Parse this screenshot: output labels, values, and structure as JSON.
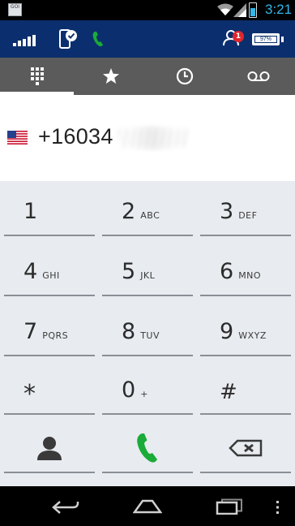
{
  "status_bar": {
    "app_icon_text": "GOI",
    "time": "3:21"
  },
  "header": {
    "contacts_badge": "1",
    "battery_percent": "97%"
  },
  "tabs": [
    {
      "name": "dialpad",
      "icon": "dialpad-icon",
      "active": true
    },
    {
      "name": "favorites",
      "icon": "star-icon",
      "active": false
    },
    {
      "name": "recents",
      "icon": "clock-icon",
      "active": false
    },
    {
      "name": "voicemail",
      "icon": "voicemail-icon",
      "active": false
    }
  ],
  "dial": {
    "country_flag": "us-flag-icon",
    "number_visible": "+16034"
  },
  "keypad": {
    "keys": [
      {
        "digit": "1",
        "letters": ""
      },
      {
        "digit": "2",
        "letters": "ABC"
      },
      {
        "digit": "3",
        "letters": "DEF"
      },
      {
        "digit": "4",
        "letters": "GHI"
      },
      {
        "digit": "5",
        "letters": "JKL"
      },
      {
        "digit": "6",
        "letters": "MNO"
      },
      {
        "digit": "7",
        "letters": "PQRS"
      },
      {
        "digit": "8",
        "letters": "TUV"
      },
      {
        "digit": "9",
        "letters": "WXYZ"
      },
      {
        "digit": "*",
        "letters": ""
      },
      {
        "digit": "0",
        "letters": "+"
      },
      {
        "digit": "#",
        "letters": ""
      }
    ],
    "bottom_row": [
      "contact-icon",
      "call-icon",
      "backspace-icon"
    ]
  },
  "colors": {
    "header_bg": "#0b2f6e",
    "tabbar_bg": "#5b5b5b",
    "keypad_bg": "#e8ebef",
    "call_green": "#1aab38",
    "status_time": "#33b5e5",
    "badge_red": "#e0262b"
  }
}
